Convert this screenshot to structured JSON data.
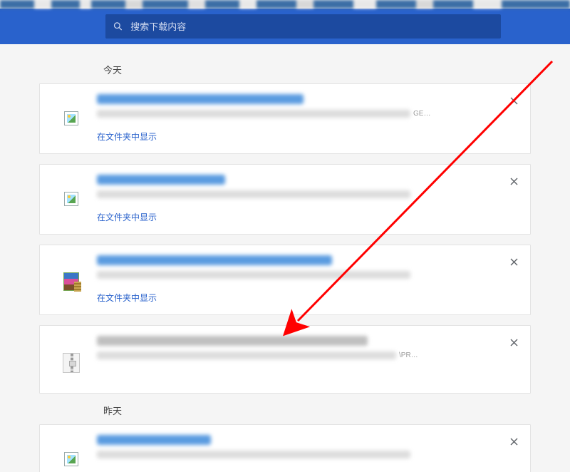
{
  "search": {
    "placeholder": "搜索下载内容"
  },
  "sections": {
    "today": "今天",
    "yesterday": "昨天"
  },
  "show_in_folder": "在文件夹中显示",
  "items": [
    {
      "icon": "image",
      "title_blur_color": "#5a9be0",
      "title_blur_width": 290,
      "sub_blur_width": 440,
      "tail": "GE…",
      "has_show_link": true
    },
    {
      "icon": "image",
      "title_blur_color": "#5a9be0",
      "title_blur_width": 180,
      "sub_blur_width": 440,
      "tail": "",
      "has_show_link": true
    },
    {
      "icon": "winrar",
      "title_blur_color": "#5a9be0",
      "title_blur_width": 330,
      "sub_blur_width": 440,
      "tail": "",
      "has_show_link": true
    },
    {
      "icon": "zip",
      "title_blur_color": "#bfbfbf",
      "title_blur_width": 380,
      "sub_blur_width": 420,
      "tail": "\\PR…",
      "has_show_link": false
    }
  ],
  "yesterday_items": [
    {
      "icon": "image",
      "title_blur_color": "#5a9be0",
      "title_blur_width": 160,
      "sub_blur_width": 440,
      "tail": "",
      "has_show_link": false
    }
  ]
}
